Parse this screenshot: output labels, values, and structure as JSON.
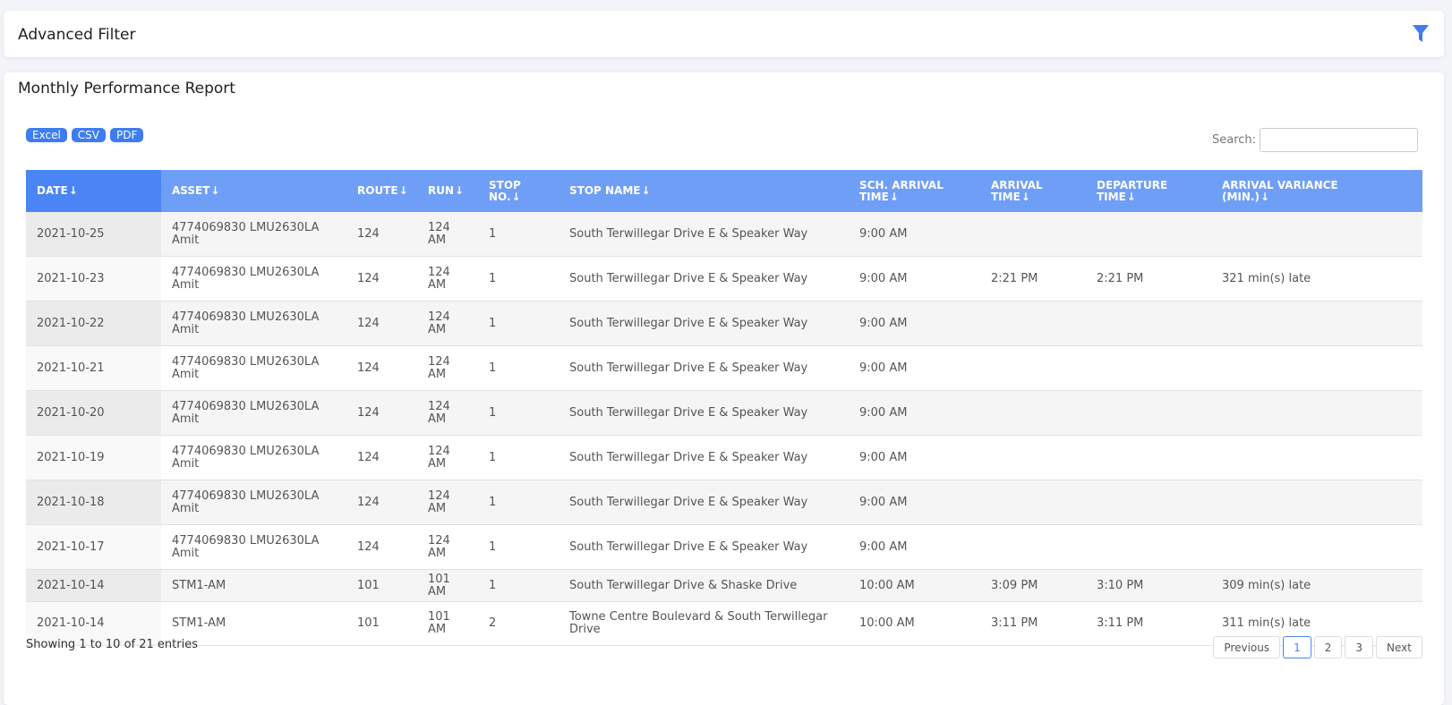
{
  "filter": {
    "title": "Advanced Filter"
  },
  "report": {
    "title": "Monthly Performance Report",
    "exports": [
      "Excel",
      "CSV",
      "PDF"
    ],
    "search_label": "Search:",
    "search_value": "",
    "columns": [
      {
        "l1": "DATE",
        "l2": ""
      },
      {
        "l1": "ASSET",
        "l2": ""
      },
      {
        "l1": "ROUTE",
        "l2": ""
      },
      {
        "l1": "RUN",
        "l2": ""
      },
      {
        "l1": "STOP",
        "l2": "NO."
      },
      {
        "l1": "STOP NAME",
        "l2": ""
      },
      {
        "l1": "SCH. ARRIVAL",
        "l2": "TIME"
      },
      {
        "l1": "ARRIVAL",
        "l2": "TIME"
      },
      {
        "l1": "DEPARTURE",
        "l2": "TIME"
      },
      {
        "l1": "ARRIVAL VARIANCE",
        "l2": "(MIN.)"
      }
    ],
    "sort_arrow": "↓",
    "rows": [
      {
        "date": "2021-10-25",
        "asset": "4774069830 LMU2630LA Amit",
        "route": "124",
        "run": "124 AM",
        "stop_no": "1",
        "stop_name": "South Terwillegar Drive E & Speaker Way",
        "sch_arrival": "9:00 AM",
        "arrival": "",
        "departure": "",
        "variance": ""
      },
      {
        "date": "2021-10-23",
        "asset": "4774069830 LMU2630LA Amit",
        "route": "124",
        "run": "124 AM",
        "stop_no": "1",
        "stop_name": "South Terwillegar Drive E & Speaker Way",
        "sch_arrival": "9:00 AM",
        "arrival": "2:21 PM",
        "departure": "2:21 PM",
        "variance": "321 min(s) late"
      },
      {
        "date": "2021-10-22",
        "asset": "4774069830 LMU2630LA Amit",
        "route": "124",
        "run": "124 AM",
        "stop_no": "1",
        "stop_name": "South Terwillegar Drive E & Speaker Way",
        "sch_arrival": "9:00 AM",
        "arrival": "",
        "departure": "",
        "variance": ""
      },
      {
        "date": "2021-10-21",
        "asset": "4774069830 LMU2630LA Amit",
        "route": "124",
        "run": "124 AM",
        "stop_no": "1",
        "stop_name": "South Terwillegar Drive E & Speaker Way",
        "sch_arrival": "9:00 AM",
        "arrival": "",
        "departure": "",
        "variance": ""
      },
      {
        "date": "2021-10-20",
        "asset": "4774069830 LMU2630LA Amit",
        "route": "124",
        "run": "124 AM",
        "stop_no": "1",
        "stop_name": "South Terwillegar Drive E & Speaker Way",
        "sch_arrival": "9:00 AM",
        "arrival": "",
        "departure": "",
        "variance": ""
      },
      {
        "date": "2021-10-19",
        "asset": "4774069830 LMU2630LA Amit",
        "route": "124",
        "run": "124 AM",
        "stop_no": "1",
        "stop_name": "South Terwillegar Drive E & Speaker Way",
        "sch_arrival": "9:00 AM",
        "arrival": "",
        "departure": "",
        "variance": ""
      },
      {
        "date": "2021-10-18",
        "asset": "4774069830 LMU2630LA Amit",
        "route": "124",
        "run": "124 AM",
        "stop_no": "1",
        "stop_name": "South Terwillegar Drive E & Speaker Way",
        "sch_arrival": "9:00 AM",
        "arrival": "",
        "departure": "",
        "variance": ""
      },
      {
        "date": "2021-10-17",
        "asset": "4774069830 LMU2630LA Amit",
        "route": "124",
        "run": "124 AM",
        "stop_no": "1",
        "stop_name": "South Terwillegar Drive E & Speaker Way",
        "sch_arrival": "9:00 AM",
        "arrival": "",
        "departure": "",
        "variance": ""
      },
      {
        "date": "2021-10-14",
        "asset": "STM1-AM",
        "route": "101",
        "run": "101 AM",
        "stop_no": "1",
        "stop_name": "South Terwillegar Drive & Shaske Drive",
        "sch_arrival": "10:00 AM",
        "arrival": "3:09 PM",
        "departure": "3:10 PM",
        "variance": "309 min(s) late"
      },
      {
        "date": "2021-10-14",
        "asset": "STM1-AM",
        "route": "101",
        "run": "101 AM",
        "stop_no": "2",
        "stop_name": "Towne Centre Boulevard & South Terwillegar Drive",
        "sch_arrival": "10:00 AM",
        "arrival": "3:11 PM",
        "departure": "3:11 PM",
        "variance": "311 min(s) late"
      }
    ],
    "info": "Showing 1 to 10 of 21 entries",
    "pager": {
      "previous": "Previous",
      "pages": [
        "1",
        "2",
        "3"
      ],
      "next": "Next",
      "active": "1"
    }
  },
  "colors": {
    "accent": "#3e7cf0",
    "header": "#6f9ef7",
    "late": "#ef2b2b"
  },
  "icons": {
    "filter": "filter-icon"
  }
}
